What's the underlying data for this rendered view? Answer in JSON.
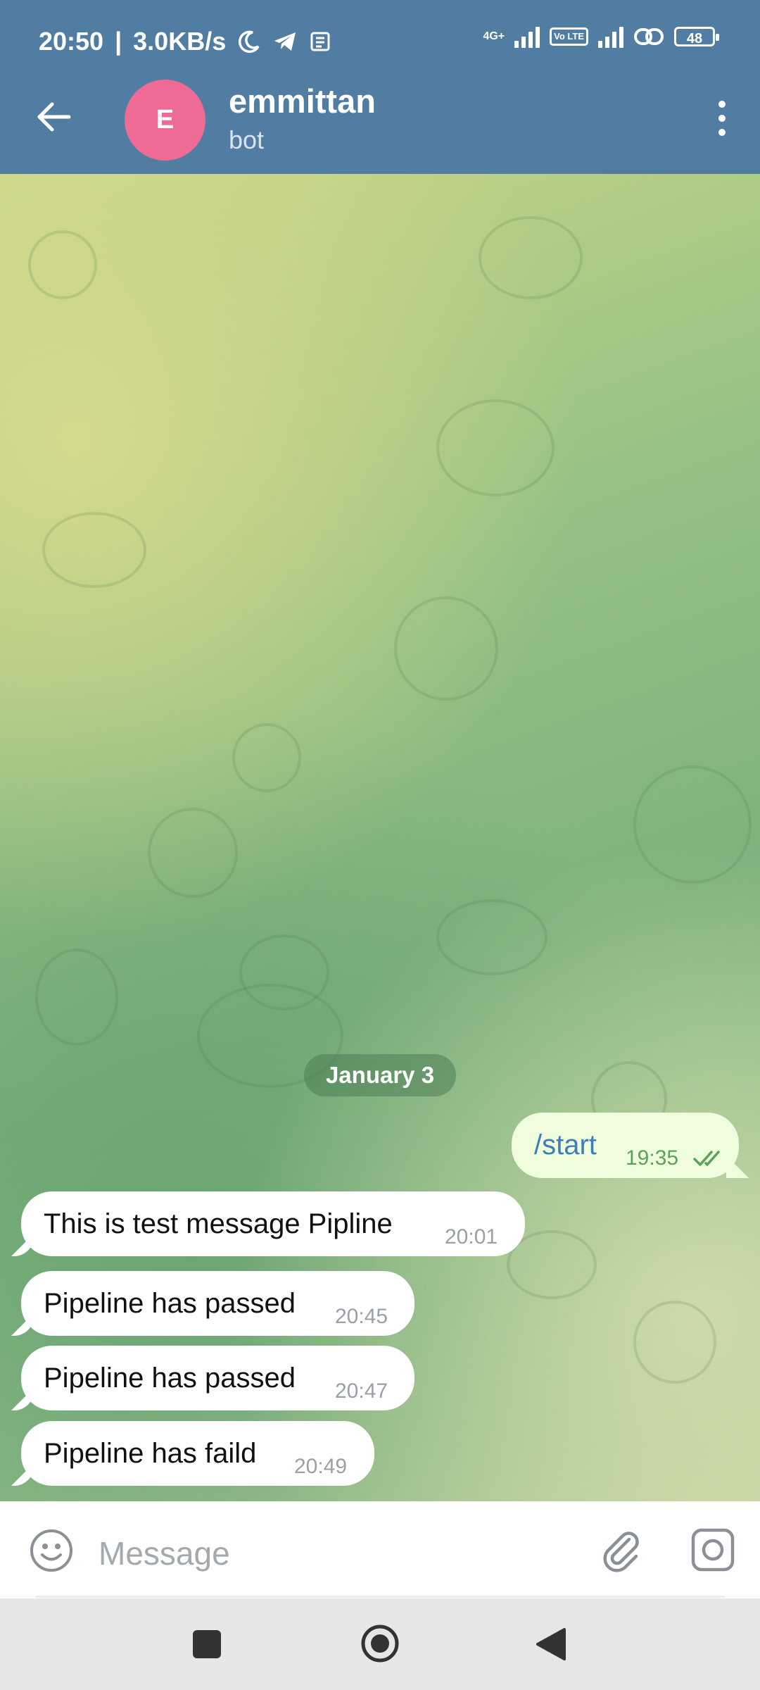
{
  "status_bar": {
    "time": "20:50",
    "speed": "3.0KB/s",
    "network_tag": "4G+",
    "volte": "Vo LTE",
    "battery": "48",
    "icons": [
      "moon-icon",
      "telegram-icon",
      "notes-icon",
      "signal-icon",
      "signal-icon",
      "link-icon",
      "battery-icon"
    ]
  },
  "header": {
    "avatar_letter": "E",
    "avatar_color": "#ee6b96",
    "title": "emmittan",
    "subtitle": "bot",
    "bar_color": "#517da2"
  },
  "chat": {
    "date_separator": "January 3",
    "messages": [
      {
        "direction": "out",
        "text": "/start",
        "time": "19:35",
        "status": "read"
      },
      {
        "direction": "in",
        "text": "This is test message Pipline",
        "time": "20:01"
      },
      {
        "direction": "in",
        "text": "Pipeline has passed",
        "time": "20:45"
      },
      {
        "direction": "in",
        "text": "Pipeline has passed",
        "time": "20:47"
      },
      {
        "direction": "in",
        "text": "Pipeline has faild",
        "time": "20:49"
      }
    ]
  },
  "composer": {
    "placeholder": "Message"
  }
}
